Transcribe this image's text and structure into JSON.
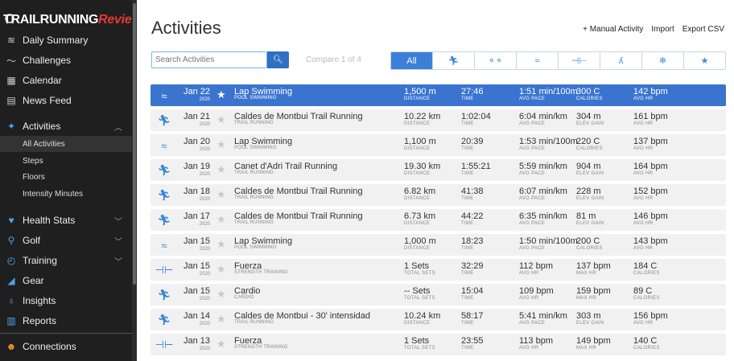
{
  "logo": {
    "white": "TRAILRUNNING",
    "red": "Review"
  },
  "sidebar": {
    "items": [
      {
        "label": "Daily Summary",
        "icon": "layers-icon",
        "glyph": "≋"
      },
      {
        "label": "Challenges",
        "icon": "wave-icon",
        "glyph": "〜"
      },
      {
        "label": "Calendar",
        "icon": "calendar-icon",
        "glyph": "▦"
      },
      {
        "label": "News Feed",
        "icon": "newspaper-icon",
        "glyph": "▤"
      },
      {
        "label": "Activities",
        "icon": "runner-icon",
        "glyph": "✦"
      },
      {
        "label": "Health Stats",
        "icon": "heart-icon",
        "glyph": "♥"
      },
      {
        "label": "Golf",
        "icon": "golfer-icon",
        "glyph": "⚲"
      },
      {
        "label": "Training",
        "icon": "stopwatch-icon",
        "glyph": "◴"
      },
      {
        "label": "Gear",
        "icon": "shoe-icon",
        "glyph": "◢"
      },
      {
        "label": "Insights",
        "icon": "lightbulb-icon",
        "glyph": "♁"
      },
      {
        "label": "Reports",
        "icon": "bar-chart-icon",
        "glyph": "▥"
      },
      {
        "label": "Connections",
        "icon": "people-icon",
        "glyph": "☻"
      }
    ],
    "sub_items": [
      {
        "label": "All Activities"
      },
      {
        "label": "Steps"
      },
      {
        "label": "Floors"
      },
      {
        "label": "Intensity Minutes"
      }
    ]
  },
  "main": {
    "title": "Activities",
    "links": {
      "manual": "+ Manual Activity",
      "import": "Import",
      "export": "Export CSV"
    },
    "search_placeholder": "Search Activities",
    "compare": "Compare 1 of 4",
    "filters": [
      {
        "label": "All"
      },
      {
        "label": "",
        "icon": "running-filter-icon",
        "glyph": "🏃︎"
      },
      {
        "label": "",
        "icon": "cycling-filter-icon",
        "glyph": "⚬⚬"
      },
      {
        "label": "",
        "icon": "swimming-filter-icon",
        "glyph": "≈"
      },
      {
        "label": "",
        "icon": "strength-filter-icon",
        "glyph": "⊣⊢"
      },
      {
        "label": "",
        "icon": "walking-filter-icon",
        "glyph": "ʎ"
      },
      {
        "label": "",
        "icon": "winter-filter-icon",
        "glyph": "❄"
      },
      {
        "label": "",
        "icon": "favorites-filter-icon",
        "glyph": "★"
      }
    ]
  },
  "activities": [
    {
      "date": "Jan 22",
      "year": "2020",
      "name": "Lap Swimming",
      "type": "POOL SWIMMING",
      "icon": "swimming-icon",
      "glyph": "≈",
      "m": [
        [
          "1,500 m",
          "DISTANCE"
        ],
        [
          "27:46",
          "TIME"
        ],
        [
          "1:51 min/100m",
          "AVG PACE"
        ],
        [
          "300 C",
          "CALORIES"
        ],
        [
          "142 bpm",
          "AVG HR"
        ]
      ]
    },
    {
      "date": "Jan 21",
      "year": "2020",
      "name": "Caldes de Montbui Trail Running",
      "type": "TRAIL RUNNING",
      "icon": "running-icon",
      "glyph": "🏃︎",
      "m": [
        [
          "10.22 km",
          "DISTANCE"
        ],
        [
          "1:02:04",
          "TIME"
        ],
        [
          "6:04 min/km",
          "AVG PACE"
        ],
        [
          "304 m",
          "ELEV GAIN"
        ],
        [
          "161 bpm",
          "AVG HR"
        ]
      ]
    },
    {
      "date": "Jan 20",
      "year": "2020",
      "name": "Lap Swimming",
      "type": "POOL SWIMMING",
      "icon": "swimming-icon",
      "glyph": "≈",
      "m": [
        [
          "1,100 m",
          "DISTANCE"
        ],
        [
          "20:39",
          "TIME"
        ],
        [
          "1:53 min/100m",
          "AVG PACE"
        ],
        [
          "220 C",
          "CALORIES"
        ],
        [
          "137 bpm",
          "AVG HR"
        ]
      ]
    },
    {
      "date": "Jan 19",
      "year": "2020",
      "name": "Canet d'Adri Trail Running",
      "type": "TRAIL RUNNING",
      "icon": "running-icon",
      "glyph": "🏃︎",
      "m": [
        [
          "19.30 km",
          "DISTANCE"
        ],
        [
          "1:55:21",
          "TIME"
        ],
        [
          "5:59 min/km",
          "AVG PACE"
        ],
        [
          "904 m",
          "ELEV GAIN"
        ],
        [
          "164 bpm",
          "AVG HR"
        ]
      ]
    },
    {
      "date": "Jan 18",
      "year": "2020",
      "name": "Caldes de Montbui Trail Running",
      "type": "TRAIL RUNNING",
      "icon": "running-icon",
      "glyph": "🏃︎",
      "m": [
        [
          "6.82 km",
          "DISTANCE"
        ],
        [
          "41:38",
          "TIME"
        ],
        [
          "6:07 min/km",
          "AVG PACE"
        ],
        [
          "228 m",
          "ELEV GAIN"
        ],
        [
          "152 bpm",
          "AVG HR"
        ]
      ]
    },
    {
      "date": "Jan 17",
      "year": "2020",
      "name": "Caldes de Montbui Trail Running",
      "type": "TRAIL RUNNING",
      "icon": "running-icon",
      "glyph": "🏃︎",
      "m": [
        [
          "6.73 km",
          "DISTANCE"
        ],
        [
          "44:22",
          "TIME"
        ],
        [
          "6:35 min/km",
          "AVG PACE"
        ],
        [
          "81 m",
          "ELEV GAIN"
        ],
        [
          "146 bpm",
          "AVG HR"
        ]
      ]
    },
    {
      "date": "Jan 15",
      "year": "2020",
      "name": "Lap Swimming",
      "type": "POOL SWIMMING",
      "icon": "swimming-icon",
      "glyph": "≈",
      "m": [
        [
          "1,000 m",
          "DISTANCE"
        ],
        [
          "18:23",
          "TIME"
        ],
        [
          "1:50 min/100m",
          "AVG PACE"
        ],
        [
          "200 C",
          "CALORIES"
        ],
        [
          "143 bpm",
          "AVG HR"
        ]
      ]
    },
    {
      "date": "Jan 15",
      "year": "2020",
      "name": "Fuerza",
      "type": "STRENGTH TRAINING",
      "icon": "dumbbell-icon",
      "glyph": "⊣⊢",
      "m": [
        [
          "1 Sets",
          "TOTAL SETS"
        ],
        [
          "32:29",
          "TIME"
        ],
        [
          "112 bpm",
          "AVG HR"
        ],
        [
          "137 bpm",
          "MAX HR"
        ],
        [
          "184 C",
          "CALORIES"
        ]
      ]
    },
    {
      "date": "Jan 15",
      "year": "2020",
      "name": "Cardio",
      "type": "CARDIO",
      "icon": "cardio-icon",
      "glyph": "🏃︎",
      "m": [
        [
          "-- Sets",
          "TOTAL SETS"
        ],
        [
          "15:04",
          "TIME"
        ],
        [
          "109 bpm",
          "AVG HR"
        ],
        [
          "159 bpm",
          "MAX HR"
        ],
        [
          "89 C",
          "CALORIES"
        ]
      ]
    },
    {
      "date": "Jan 14",
      "year": "2020",
      "name": "Caldes de Montbui - 30' intensidad",
      "type": "TRAIL RUNNING",
      "icon": "running-icon",
      "glyph": "🏃︎",
      "m": [
        [
          "10.24 km",
          "DISTANCE"
        ],
        [
          "58:17",
          "TIME"
        ],
        [
          "5:41 min/km",
          "AVG PACE"
        ],
        [
          "303 m",
          "ELEV GAIN"
        ],
        [
          "156 bpm",
          "AVG HR"
        ]
      ]
    },
    {
      "date": "Jan 13",
      "year": "2020",
      "name": "Fuerza",
      "type": "STRENGTH TRAINING",
      "icon": "dumbbell-icon",
      "glyph": "⊣⊢",
      "m": [
        [
          "1 Sets",
          "TOTAL SETS"
        ],
        [
          "23:55",
          "TIME"
        ],
        [
          "113 bpm",
          "AVG HR"
        ],
        [
          "149 bpm",
          "MAX HR"
        ],
        [
          "140 C",
          "CALORIES"
        ]
      ]
    }
  ],
  "selected_row": 0,
  "colors": {
    "accent": "#3b7fd8",
    "sidebar_bg": "#1f1f1f",
    "row_bg": "#f1f1f1"
  }
}
